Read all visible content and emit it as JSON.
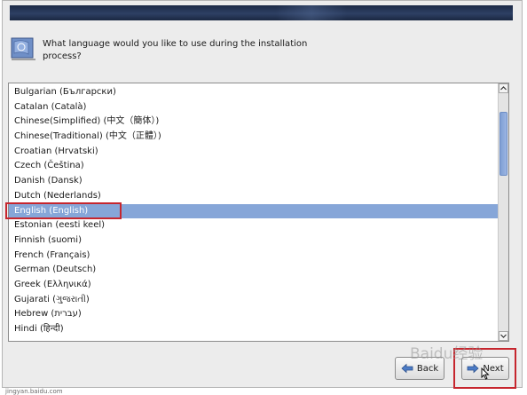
{
  "installer": {
    "question": "What language would you like to use during the installation process?"
  },
  "languages": [
    {
      "label": "Bulgarian (Български)",
      "selected": false
    },
    {
      "label": "Catalan (Català)",
      "selected": false
    },
    {
      "label": "Chinese(Simplified) (中文（簡体）)",
      "selected": false
    },
    {
      "label": "Chinese(Traditional) (中文（正體）)",
      "selected": false
    },
    {
      "label": "Croatian (Hrvatski)",
      "selected": false
    },
    {
      "label": "Czech (Čeština)",
      "selected": false
    },
    {
      "label": "Danish (Dansk)",
      "selected": false
    },
    {
      "label": "Dutch (Nederlands)",
      "selected": false
    },
    {
      "label": "English (English)",
      "selected": true
    },
    {
      "label": "Estonian (eesti keel)",
      "selected": false
    },
    {
      "label": "Finnish (suomi)",
      "selected": false
    },
    {
      "label": "French (Français)",
      "selected": false
    },
    {
      "label": "German (Deutsch)",
      "selected": false
    },
    {
      "label": "Greek (Ελληνικά)",
      "selected": false
    },
    {
      "label": "Gujarati (ગુજરાતી)",
      "selected": false
    },
    {
      "label": "Hebrew (עברית)",
      "selected": false
    },
    {
      "label": "Hindi (हिन्दी)",
      "selected": false
    }
  ],
  "buttons": {
    "back_label": "Back",
    "next_label": "Next"
  },
  "watermark": "Baidu经验",
  "footer": "jingyan.baidu.com",
  "colors": {
    "selection": "#86a6d8",
    "annotation_red": "#c6262e",
    "banner": "#2e4064"
  }
}
